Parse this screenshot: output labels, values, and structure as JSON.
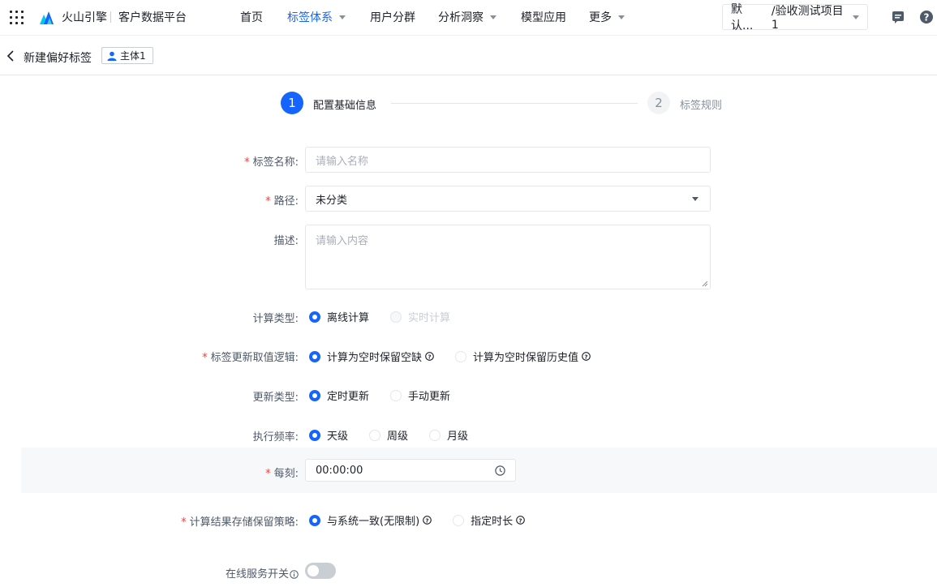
{
  "nav": {
    "brand": "火山引擎",
    "platform": "客户数据平台",
    "items": [
      {
        "label": "首页",
        "dropdown": false,
        "active": false
      },
      {
        "label": "标签体系",
        "dropdown": true,
        "active": true
      },
      {
        "label": "用户分群",
        "dropdown": false,
        "active": false
      },
      {
        "label": "分析洞察",
        "dropdown": true,
        "active": false
      },
      {
        "label": "模型应用",
        "dropdown": false,
        "active": false
      },
      {
        "label": "更多",
        "dropdown": true,
        "active": false
      }
    ],
    "project_short": "默认...",
    "project_name": "/验收测试项目1"
  },
  "subheader": {
    "title": "新建偏好标签",
    "entity_tag": "主体1"
  },
  "steps": [
    {
      "number": "1",
      "label": "配置基础信息",
      "active": true
    },
    {
      "number": "2",
      "label": "标签规则",
      "active": false
    }
  ],
  "form": {
    "tag_name": {
      "label": "标签名称:",
      "required": true,
      "placeholder": "请输入名称"
    },
    "path": {
      "label": "路径:",
      "required": true,
      "value": "未分类"
    },
    "description": {
      "label": "描述:",
      "required": false,
      "placeholder": "请输入内容"
    },
    "calc_type": {
      "label": "计算类型:",
      "options": [
        "离线计算",
        "实时计算"
      ],
      "selected": 0,
      "disabled": [
        1
      ]
    },
    "update_logic": {
      "label": "标签更新取值逻辑:",
      "required": true,
      "options": [
        "计算为空时保留空缺",
        "计算为空时保留历史值"
      ],
      "selected": 0
    },
    "update_type": {
      "label": "更新类型:",
      "options": [
        "定时更新",
        "手动更新"
      ],
      "selected": 0
    },
    "frequency": {
      "label": "执行频率:",
      "options": [
        "天级",
        "周级",
        "月级"
      ],
      "selected": 0
    },
    "time": {
      "label": "每刻:",
      "required": true,
      "value": "00:00:00"
    },
    "retention": {
      "label": "计算结果存储保留策略:",
      "required": true,
      "options": [
        "与系统一致(无限制)",
        "指定时长"
      ],
      "selected": 0
    },
    "online_service": {
      "label": "在线服务开关",
      "enabled": false
    }
  },
  "colors": {
    "primary": "#1664ff",
    "required": "#f53f3f",
    "text": "#1d2129",
    "muted": "#86909c"
  }
}
